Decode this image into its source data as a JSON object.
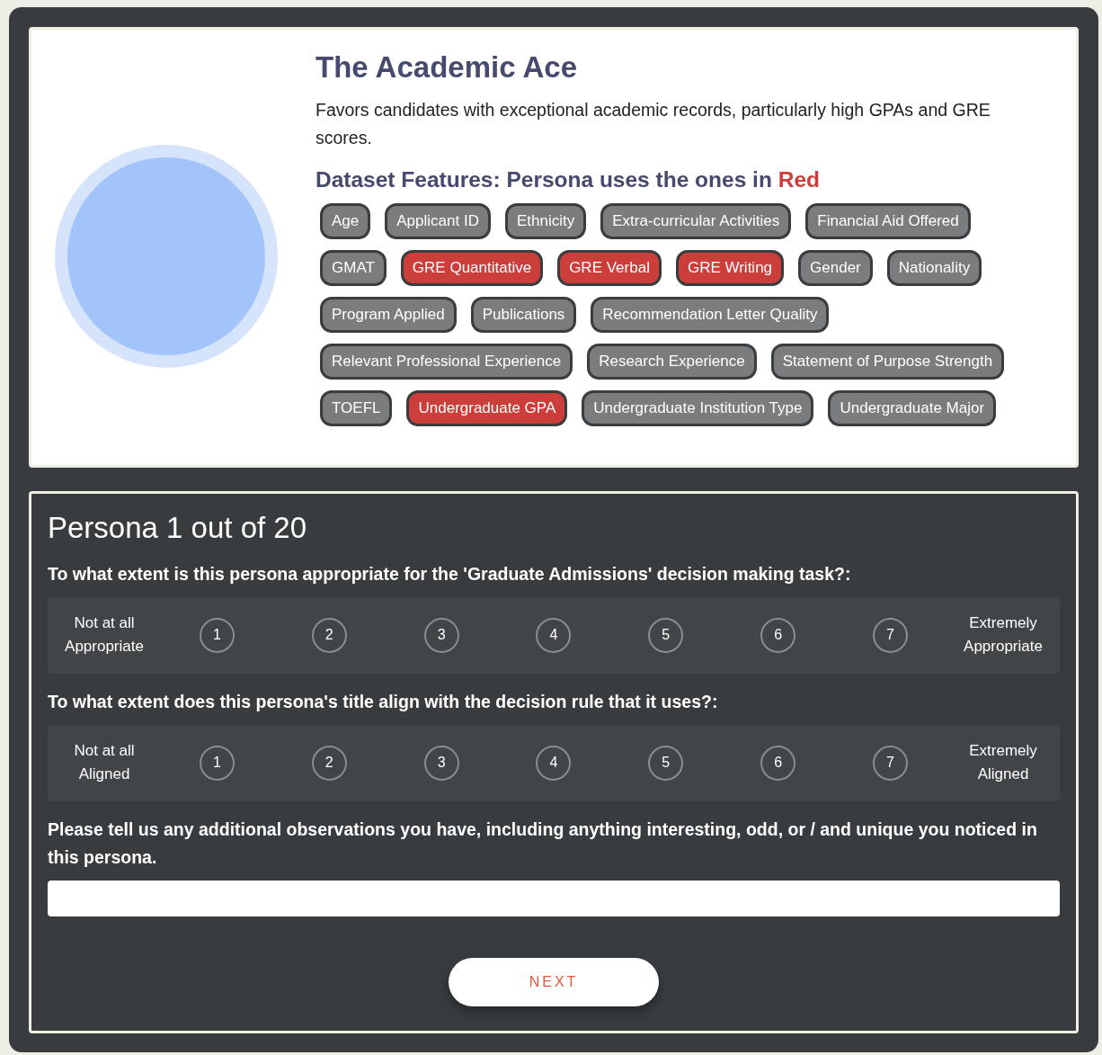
{
  "persona": {
    "title": "The Academic Ace",
    "description": "Favors candidates with exceptional academic records, particularly high GPAs and GRE scores.",
    "features_heading": {
      "text": "Dataset Features: Persona uses the ones in",
      "highlight": "Red"
    },
    "features": [
      {
        "label": "Age",
        "used": false
      },
      {
        "label": "Applicant ID",
        "used": false
      },
      {
        "label": "Ethnicity",
        "used": false
      },
      {
        "label": "Extra-curricular Activities",
        "used": false
      },
      {
        "label": "Financial Aid Offered",
        "used": false
      },
      {
        "label": "GMAT",
        "used": false
      },
      {
        "label": "GRE Quantitative",
        "used": true
      },
      {
        "label": "GRE Verbal",
        "used": true
      },
      {
        "label": "GRE Writing",
        "used": true
      },
      {
        "label": "Gender",
        "used": false
      },
      {
        "label": "Nationality",
        "used": false
      },
      {
        "label": "Program Applied",
        "used": false
      },
      {
        "label": "Publications",
        "used": false
      },
      {
        "label": "Recommendation Letter Quality",
        "used": false
      },
      {
        "label": "Relevant Professional Experience",
        "used": false
      },
      {
        "label": "Research Experience",
        "used": false
      },
      {
        "label": "Statement of Purpose Strength",
        "used": false
      },
      {
        "label": "TOEFL",
        "used": false
      },
      {
        "label": "Undergraduate GPA",
        "used": true
      },
      {
        "label": "Undergraduate Institution Type",
        "used": false
      },
      {
        "label": "Undergraduate Major",
        "used": false
      }
    ]
  },
  "survey": {
    "heading": "Persona 1 out of 20",
    "questions": [
      {
        "kind": "scale",
        "text": "To what extent is this persona appropriate for the 'Graduate Admissions' decision making task?:",
        "low": [
          "Not at all",
          "Appropriate"
        ],
        "high": [
          "Extremely",
          "Appropriate"
        ],
        "options": [
          {
            "label": "1",
            "selected": false
          },
          {
            "label": "2",
            "selected": false
          },
          {
            "label": "3",
            "selected": false
          },
          {
            "label": "4",
            "selected": false
          },
          {
            "label": "5",
            "selected": false
          },
          {
            "label": "6",
            "selected": false
          },
          {
            "label": "7",
            "selected": false
          }
        ]
      },
      {
        "kind": "scale",
        "text": "To what extent does this persona's title align with the decision rule that it uses?:",
        "low": [
          "Not at all",
          "Aligned"
        ],
        "high": [
          "Extremely",
          "Aligned"
        ],
        "options": [
          {
            "label": "1",
            "selected": false
          },
          {
            "label": "2",
            "selected": false
          },
          {
            "label": "3",
            "selected": false
          },
          {
            "label": "4",
            "selected": false
          },
          {
            "label": "5",
            "selected": false
          },
          {
            "label": "6",
            "selected": false
          },
          {
            "label": "7",
            "selected": false
          }
        ]
      },
      {
        "kind": "text",
        "text": "Please tell us any additional observations you have, including anything interesting, odd, or / and unique you noticed in this persona."
      }
    ],
    "next_button": "NEXT"
  }
}
